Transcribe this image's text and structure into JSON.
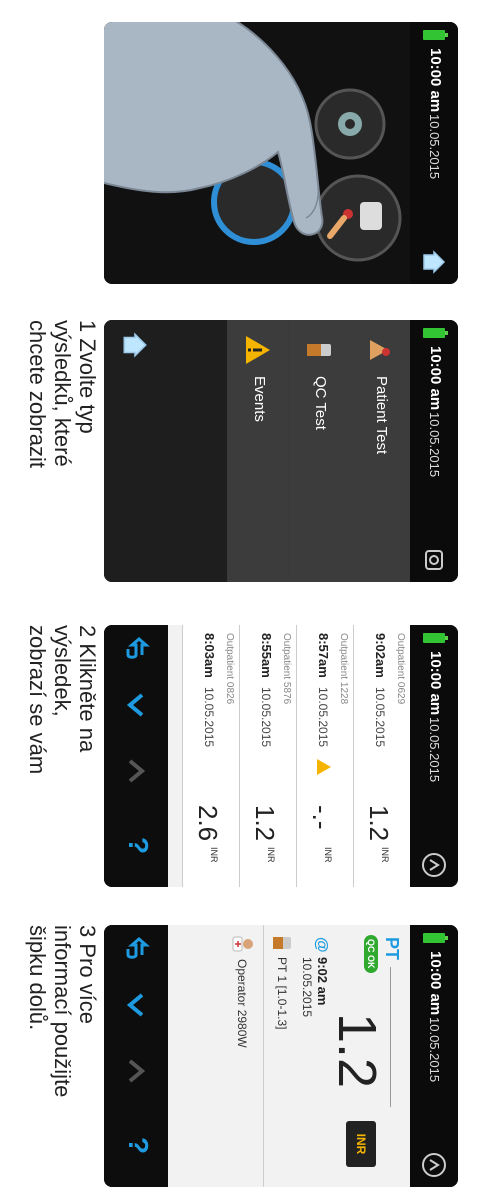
{
  "status": {
    "time": "10:00 am",
    "date": "10.05.2015"
  },
  "menu": {
    "items": [
      {
        "label": "Patient Test",
        "icon": "patient-test-icon"
      },
      {
        "label": "QC Test",
        "icon": "qc-vial-icon"
      },
      {
        "label": "Events",
        "icon": "warning-icon"
      }
    ]
  },
  "results": {
    "rows": [
      {
        "patient": "Outpatient 0629",
        "time": "9:02am",
        "date": "10.05.2015",
        "value": "1.2",
        "unit": "INR",
        "warning": false
      },
      {
        "patient": "Outpatient 1228",
        "time": "8:57am",
        "date": "10.05.2015",
        "value": "-.-",
        "unit": "INR",
        "warning": true
      },
      {
        "patient": "Outpatient 5876",
        "time": "8:55am",
        "date": "10.05.2015",
        "value": "1.2",
        "unit": "INR",
        "warning": false
      },
      {
        "patient": "Outpatient 0826",
        "time": "8:03am",
        "date": "10.05.2015",
        "value": "2.6",
        "unit": "INR",
        "warning": false
      }
    ]
  },
  "detail": {
    "test": "PT",
    "value": "1.2",
    "unit": "INR",
    "qc": "QC OK",
    "time": "9:02 am",
    "date": "10.05.2015",
    "strip": "PT 1 [1.0-1.3]",
    "operator": "Operator 2980W"
  },
  "nav": {
    "help": "?"
  },
  "captions": {
    "step1": "1 Zvolte typ\nvýsledků, které\nchcete zobrazit",
    "step2": "2 Klikněte na\nvýsledek,\nzobrazí se vám",
    "step3": "3  Pro více\ninformací použijte\nšipku dolů."
  },
  "colors": {
    "battery": "#33c433",
    "accent": "#1e9be0",
    "warning": "#f5b400",
    "qc_ok": "#2faa2f"
  }
}
